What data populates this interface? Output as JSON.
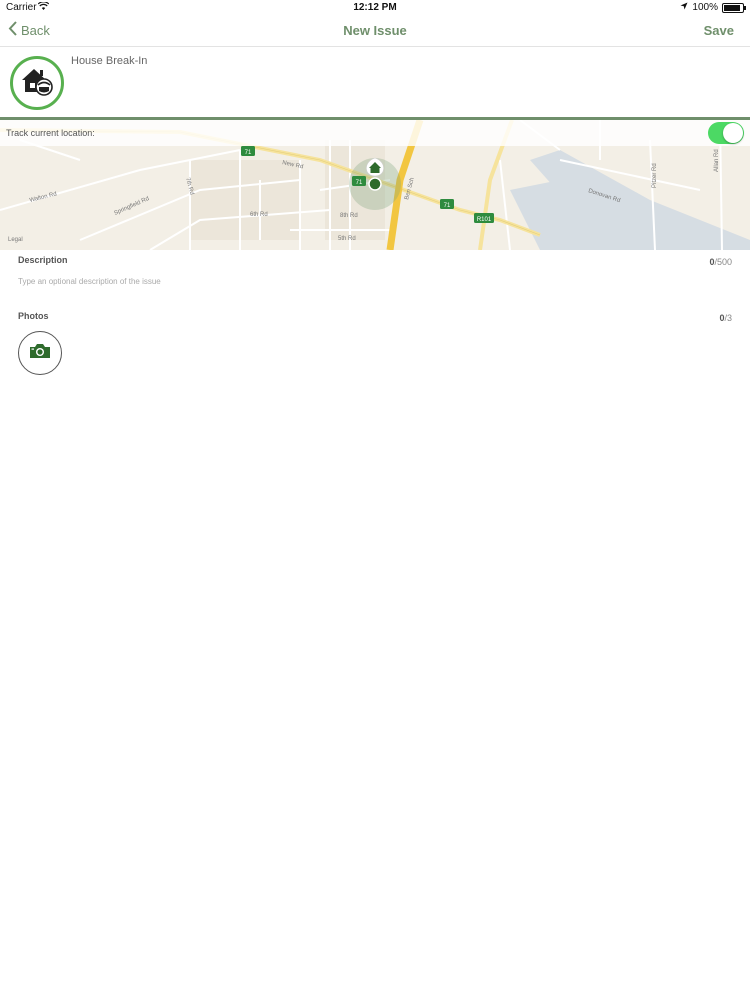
{
  "status_bar": {
    "carrier": "Carrier",
    "time": "12:12 PM",
    "battery": "100%",
    "battery_level": 1.0
  },
  "nav": {
    "back_label": "Back",
    "title": "New Issue",
    "save_label": "Save"
  },
  "issue": {
    "name": "House Break-In",
    "icon": "house-break-in-icon"
  },
  "map": {
    "track_label": "Track current location:",
    "track_enabled": true,
    "labels": {
      "new_rd": "New Rd",
      "walton_rd": "Walton Rd",
      "springfield_rd": "Springfield Rd",
      "seventh_rd": "7th Rd",
      "sixth_rd": "6th Rd",
      "fifth_rd": "5th Rd",
      "eighth_rd": "8th Rd",
      "ben_sch": "Ben Sch",
      "donovan_rd": "Donovan Rd",
      "allan_rd": "Allan Rd",
      "pitzer_rd": "Pitzer Rd",
      "legal": "Legal",
      "route_71": "71",
      "route_r101": "R101"
    }
  },
  "description": {
    "label": "Description",
    "count": "0",
    "max": "/500",
    "placeholder": "Type an optional description of the issue"
  },
  "photos": {
    "label": "Photos",
    "count": "0",
    "max": "/3"
  },
  "colors": {
    "accent": "#6f8f6b",
    "toggle_on": "#4cd964",
    "avatar_ring": "#58b04f",
    "marker": "#2e6b2c"
  }
}
